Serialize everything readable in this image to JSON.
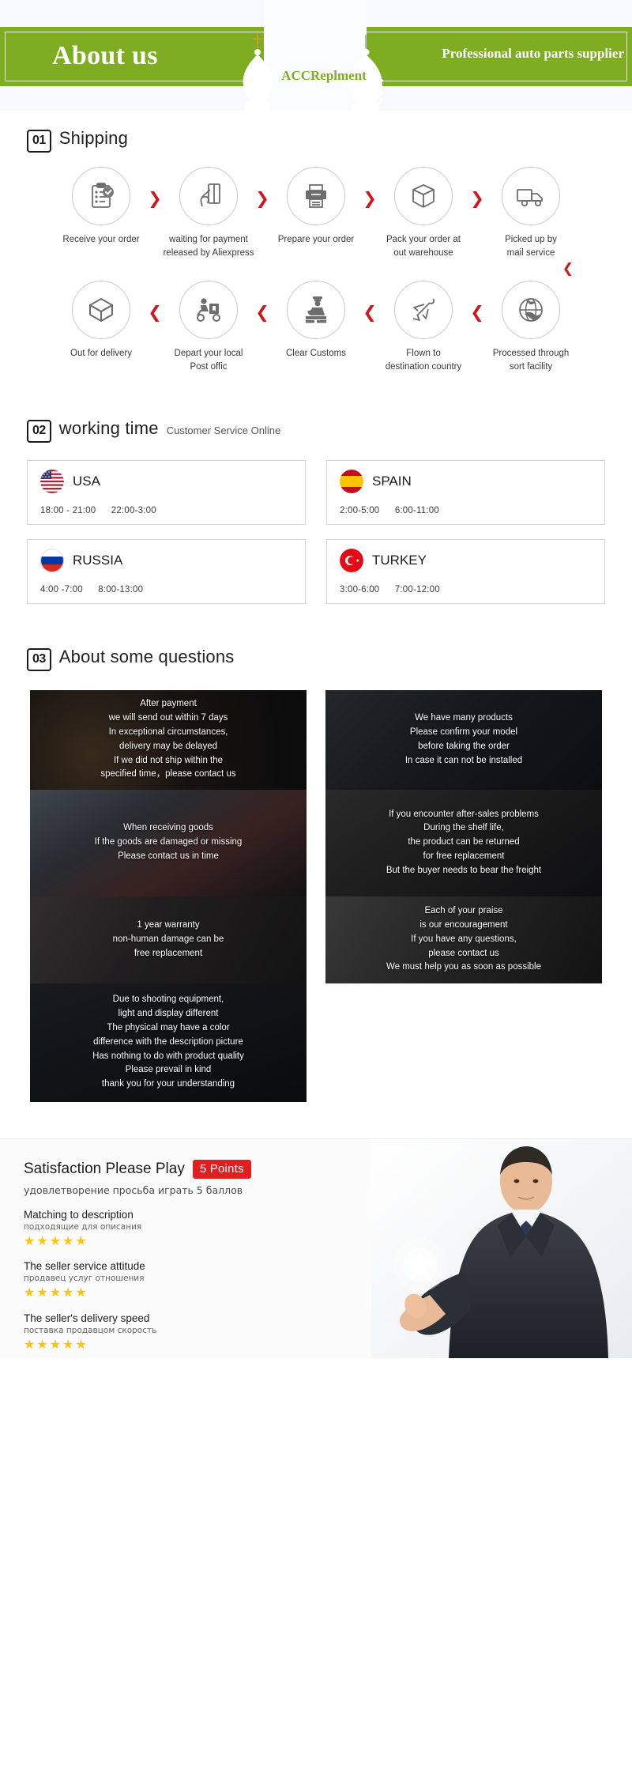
{
  "header": {
    "title": "About us",
    "tagline": "Professional auto parts supplier",
    "brand": "ACCReplment",
    "green": "#7fad22"
  },
  "sections": {
    "shipping": {
      "num": "01",
      "title": "Shipping"
    },
    "working": {
      "num": "02",
      "title": "working time",
      "note": "Customer Service Online"
    },
    "faq": {
      "num": "03",
      "title": "About some questions"
    }
  },
  "shipping": {
    "row1": [
      {
        "icon": "clipboard-check-icon",
        "label": "Receive your order"
      },
      {
        "icon": "hand-card-icon",
        "label": "waiting for payment\nreleased by Aliexpress"
      },
      {
        "icon": "printer-icon",
        "label": "Prepare your order"
      },
      {
        "icon": "box-icon",
        "label": "Pack your order at\nout warehouse"
      },
      {
        "icon": "truck-icon",
        "label": "Picked up by\nmail service"
      }
    ],
    "row2": [
      {
        "icon": "open-box-icon",
        "label": "Out  for delivery"
      },
      {
        "icon": "scooter-icon",
        "label": "Depart your local\nPost offic"
      },
      {
        "icon": "customs-officer-icon",
        "label": "Clear Customs"
      },
      {
        "icon": "airplane-icon",
        "label": "Flown to\ndestination country"
      },
      {
        "icon": "globe-icon",
        "label": "Processed through\nsort facility"
      }
    ],
    "forward_chevron": "❯",
    "back_chevron": "❮",
    "turn_chevron": "❮"
  },
  "working_time": [
    {
      "country": "USA",
      "flag": "usa-flag-icon",
      "hours": [
        "18:00 - 21:00",
        "22:00-3:00"
      ]
    },
    {
      "country": "SPAIN",
      "flag": "spain-flag-icon",
      "hours": [
        "2:00-5:00",
        "6:00-11:00"
      ]
    },
    {
      "country": "RUSSIA",
      "flag": "russia-flag-icon",
      "hours": [
        "4:00 -7:00",
        "8:00-13:00"
      ]
    },
    {
      "country": "TURKEY",
      "flag": "turkey-flag-icon",
      "hours": [
        "3:00-6:00",
        "7:00-12:00"
      ]
    }
  ],
  "faq": {
    "left": [
      {
        "text": "After payment\nwe will send out within 7 days\nIn exceptional circumstances,\ndelivery may be delayed\nIf we did not ship within the\nspecified time，please contact us",
        "tab": "#e4007f"
      },
      {
        "text": "When receiving goods\nIf the goods are damaged or missing\nPlease contact us in time",
        "tab": "#18b3c7"
      },
      {
        "text": "1 year warranty\nnon-human damage can be\nfree replacement",
        "tab": "#12c49a"
      },
      {
        "text": "Due to shooting equipment,\nlight and display different\nThe physical may have a color\ndifference with the description picture\nHas nothing to do with product quality\nPlease prevail in kind\nthank you for your understanding",
        "tab": "#e4007f"
      }
    ],
    "right": [
      {
        "text": "We have many products\nPlease confirm your model\nbefore taking the order\nIn case it can not be installed",
        "tab": "#18b3c7"
      },
      {
        "text": "If you encounter after-sales problems\nDuring the shelf life,\nthe product can be returned\nfor free replacement\nBut the buyer needs to bear the freight",
        "tab": "#18b3c7"
      },
      {
        "text": "Each of your praise\nis our encouragement\nIf you have any questions,\nplease contact us\nWe must help you as soon as possible",
        "tab": "#12c49a"
      }
    ]
  },
  "satisfaction": {
    "title": "Satisfaction Please Play",
    "points": "5 Points",
    "subtitle": "удовлетворение просьба играть 5 баллов",
    "items": [
      {
        "en": "Matching to description",
        "ru": "подходящие для описания",
        "stars": "★★★★★"
      },
      {
        "en": "The seller service attitude",
        "ru": "продавец услуг отношения",
        "stars": "★★★★★"
      },
      {
        "en": "The seller's delivery speed",
        "ru": "поставка продавцом скорость",
        "stars": "★★★★★"
      }
    ],
    "star_color": "#f5c518",
    "badge_color": "#e02020"
  }
}
